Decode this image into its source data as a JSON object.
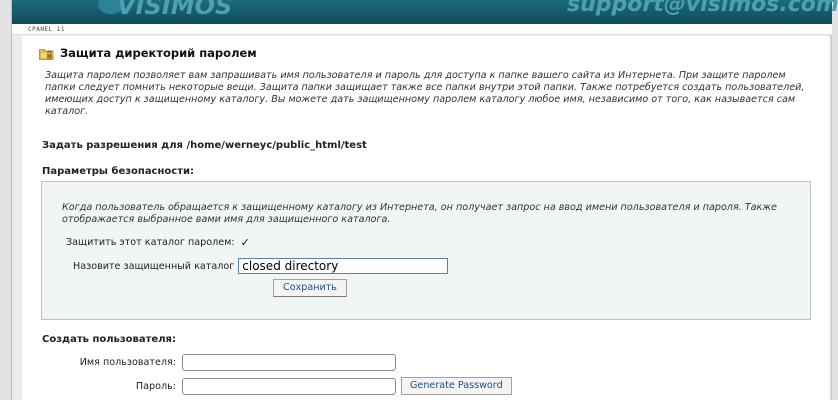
{
  "header": {
    "brand": "VISIMOS",
    "support_email": "support@visimos.com",
    "cpanel_label": "CPANEL 11"
  },
  "page": {
    "title": "Защита директорий паролем",
    "intro": "Защита паролем позволяет вам запрашивать имя пользователя и пароль для доступа к папке вашего сайта из Интернета. При защите паролем папки следует помнить некоторые вещи. Защита папки защищает также все папки внутри этой папки. Также потребуется создать пользователей, имеющих доступ к защищенному каталогу. Вы можете дать защищенному паролем каталогу любое имя, независимо от того, как называется сам каталог.",
    "permissions_line": "Задать разрешения для /home/werneyc/public_html/test"
  },
  "security": {
    "section_title": "Параметры безопасности:",
    "description": "Когда пользователь обращается к защищенному каталогу из Интернета, он получает запрос на ввод имени пользователя и пароля. Также отображается выбранное вами имя для защищенного каталога.",
    "protect_label": "Защитить этот каталог паролем:",
    "protect_checked": true,
    "checkmark": "✓",
    "dir_name_label": "Назовите защищенный каталог",
    "dir_name_value": "closed directory",
    "save_label": "Сохранить"
  },
  "create_user": {
    "section_title": "Создать пользователя:",
    "username_label": "Имя пользователя:",
    "password_label": "Пароль:",
    "generate_label": "Generate Password"
  },
  "icons": {
    "title_icon": "locked-folder-icon"
  }
}
